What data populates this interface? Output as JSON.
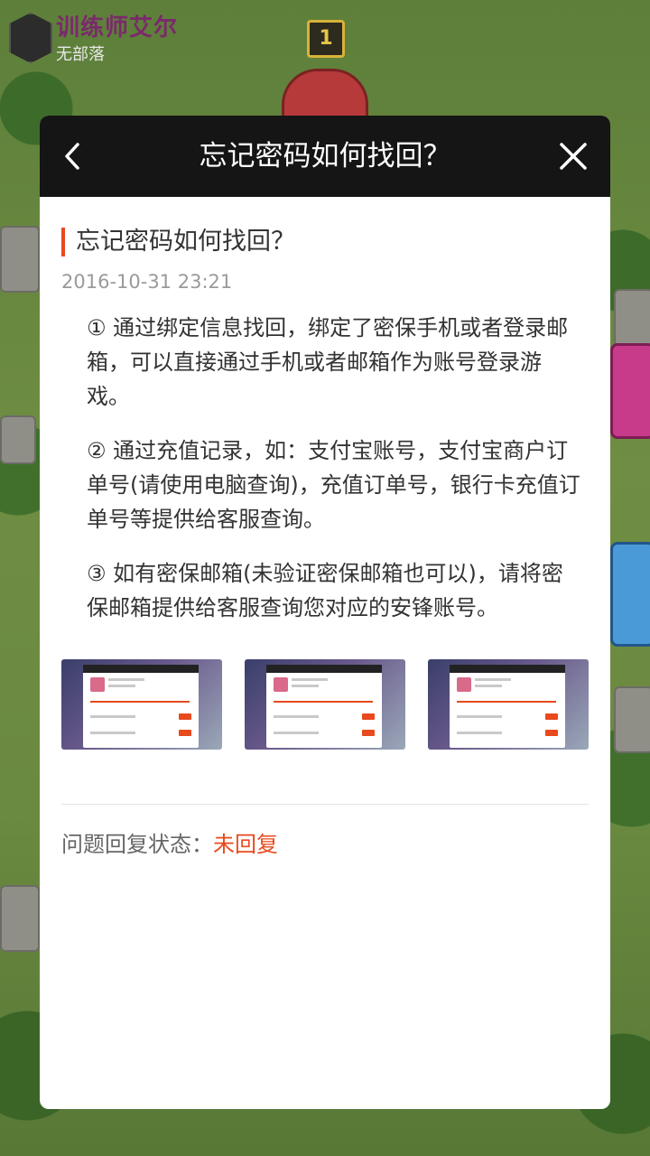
{
  "background": {
    "trainer_name": "训练师艾尔",
    "clan": "无部落",
    "crown_level": "1"
  },
  "dialog": {
    "title": "忘记密码如何找回？",
    "back_icon": "chevron-left-icon",
    "close_icon": "close-icon"
  },
  "article": {
    "title": "忘记密码如何找回？",
    "date": "2016-10-31 23:21",
    "paragraphs": [
      "① 通过绑定信息找回，绑定了密保手机或者登录邮箱，可以直接通过手机或者邮箱作为账号登录游戏。",
      "② 通过充值记录，如：支付宝账号，支付宝商户订单号(请使用电脑查询)，充值订单号，银行卡充值订单号等提供给客服查询。",
      "③ 如有密保邮箱(未验证密保邮箱也可以)，请将密保邮箱提供给客服查询您对应的安锋账号。"
    ]
  },
  "status": {
    "label": "问题回复状态：",
    "value": "未回复"
  },
  "colors": {
    "accent": "#e8491d",
    "header_bg": "#151515",
    "text": "#333333",
    "muted": "#9a9a9a"
  }
}
